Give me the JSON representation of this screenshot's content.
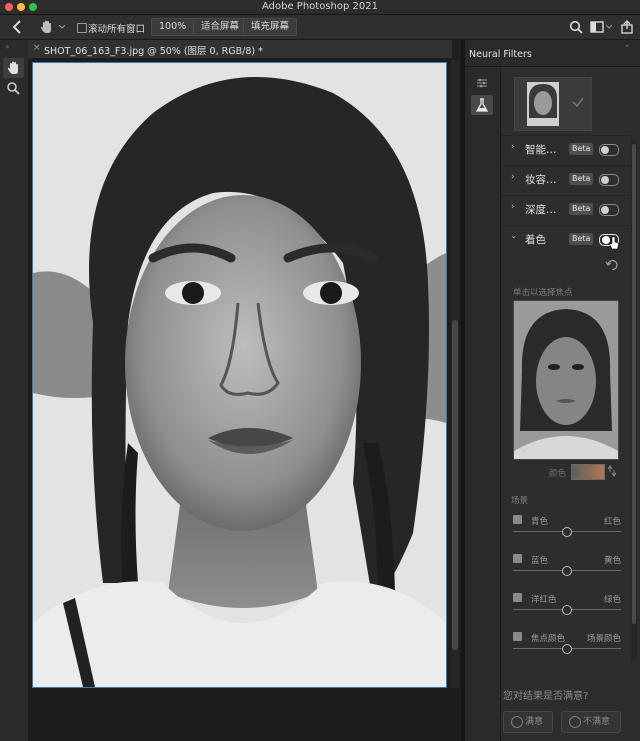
{
  "window": {
    "title": "Adobe Photoshop 2021"
  },
  "options_bar": {
    "scroll_all": "滚动所有窗口",
    "zoom_100": "100%",
    "fit_screen": "适合屏幕",
    "fill_screen": "填充屏幕"
  },
  "document_tab": {
    "title": "SHOT_06_163_F3.jpg @ 50% (图层 0, RGB/8) *"
  },
  "panel": {
    "title": "Neural Filters",
    "filters": [
      {
        "label": "智能…",
        "beta": "Beta",
        "on": false
      },
      {
        "label": "妆容…",
        "beta": "Beta",
        "on": false
      },
      {
        "label": "深度…",
        "beta": "Beta",
        "on": false
      },
      {
        "label": "着色",
        "beta": "Beta",
        "on": true
      }
    ],
    "click_hint": "单击以选择焦点",
    "color_label": "颜色",
    "scene_label": "场景",
    "sliders": [
      {
        "left": "青色",
        "right": "红色",
        "value": 0.5
      },
      {
        "left": "蓝色",
        "right": "黄色",
        "value": 0.5
      },
      {
        "left": "洋红色",
        "right": "绿色",
        "value": 0.5
      },
      {
        "left": "焦点颜色",
        "right": "场景颜色",
        "value": 0.5
      }
    ],
    "question": "您对结果是否满意?",
    "satisfied": "满意",
    "not_satisfied": "不满意"
  },
  "colors": {
    "accent": "#2f7bd4",
    "beta_bg": "#4e4e4e",
    "panel_bg": "#2d2d2d"
  }
}
